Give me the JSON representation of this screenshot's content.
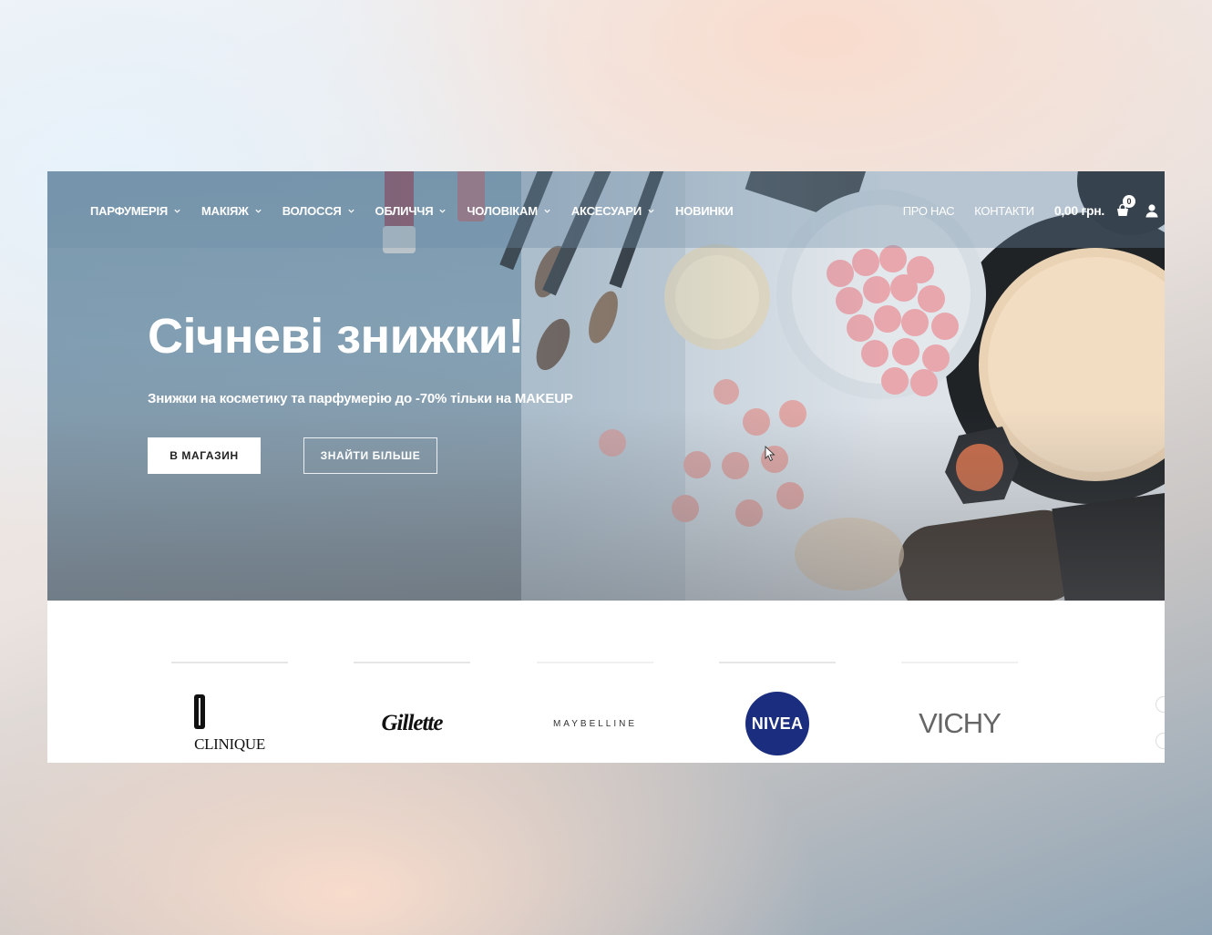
{
  "nav": {
    "menu": [
      {
        "label": "ПАРФУМЕРІЯ",
        "has_dropdown": true
      },
      {
        "label": "МАКІЯЖ",
        "has_dropdown": true
      },
      {
        "label": "ВОЛОССЯ",
        "has_dropdown": true
      },
      {
        "label": "ОБЛИЧЧЯ",
        "has_dropdown": true
      },
      {
        "label": "ЧОЛОВІКАМ",
        "has_dropdown": true
      },
      {
        "label": "АКСЕСУАРИ",
        "has_dropdown": true
      },
      {
        "label": "НОВИНКИ",
        "has_dropdown": false
      }
    ],
    "links": {
      "about": "ПРО НАС",
      "contacts": "КОНТАКТИ"
    },
    "cart_total": "0,00 грн.",
    "cart_count": "0",
    "icons": [
      "chevron-down-icon",
      "cart-icon",
      "user-icon"
    ]
  },
  "hero": {
    "title": "Січневі знижки!",
    "subtitle": "Знижки на косметику та парфумерію до -70% тільки на MAKEUP",
    "primary_button": "В МАГАЗИН",
    "secondary_button": "ЗНАЙТИ БІЛЬШЕ"
  },
  "brands": {
    "clinique": "CLINIQUE",
    "gillette": "Gillette",
    "maybelline": "MAYBELLINE",
    "nivea": "NIVEA",
    "vichy": "VICHY"
  },
  "colors": {
    "nivea_blue": "#1b2d7e",
    "hero_overlay": "#7f9db2"
  }
}
